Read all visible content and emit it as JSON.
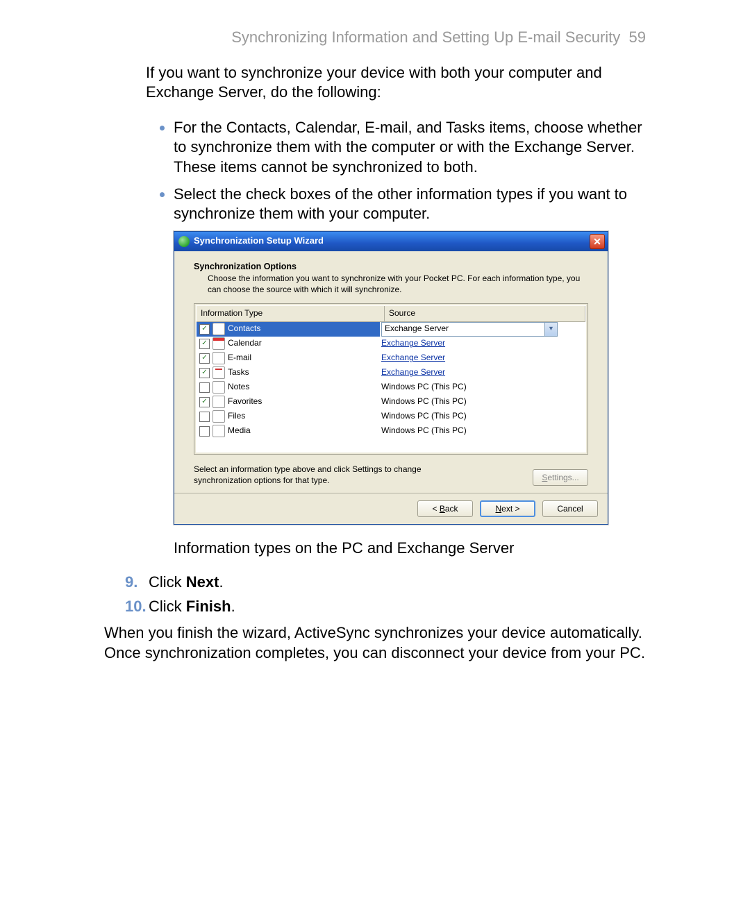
{
  "header": {
    "title": "Synchronizing Information and Setting Up E-mail Security",
    "page_number": "59"
  },
  "intro": "If you want to synchronize your device with both your computer and Exchange Server, do the following:",
  "bullets": [
    "For the Contacts, Calendar, E-mail, and Tasks items, choose whether to synchronize them with the computer or with the Exchange Server. These items cannot be synchronized to both.",
    "Select the check boxes of the other information types if you want to synchronize them with your computer."
  ],
  "dialog": {
    "title": "Synchronization Setup Wizard",
    "section_title": "Synchronization Options",
    "section_desc": "Choose the information you want to synchronize with your Pocket PC.  For each information type, you can choose the source with which it will synchronize.",
    "col1": "Information Type",
    "col2": "Source",
    "rows": [
      {
        "checked": true,
        "selected": true,
        "icon": "ic-contacts",
        "label": "Contacts",
        "source": "Exchange Server",
        "combo": true
      },
      {
        "checked": true,
        "selected": false,
        "icon": "ic-calendar",
        "label": "Calendar",
        "source": "Exchange Server",
        "link": true
      },
      {
        "checked": true,
        "selected": false,
        "icon": "ic-email",
        "label": "E-mail",
        "source": "Exchange Server",
        "link": true
      },
      {
        "checked": true,
        "selected": false,
        "icon": "ic-tasks",
        "label": "Tasks",
        "source": "Exchange Server",
        "link": true
      },
      {
        "checked": false,
        "selected": false,
        "icon": "ic-notes",
        "label": "Notes",
        "source": "Windows PC (This PC)"
      },
      {
        "checked": true,
        "selected": false,
        "icon": "ic-fav",
        "label": "Favorites",
        "source": "Windows PC (This PC)"
      },
      {
        "checked": false,
        "selected": false,
        "icon": "ic-files",
        "label": "Files",
        "source": "Windows PC (This PC)"
      },
      {
        "checked": false,
        "selected": false,
        "icon": "ic-media",
        "label": "Media",
        "source": "Windows PC (This PC)"
      }
    ],
    "hint": "Select an information type above and click Settings to change synchronization options for that type.",
    "settings_label": "Settings...",
    "back_label": "< Back",
    "next_label": "Next >",
    "cancel_label": "Cancel"
  },
  "caption": "Information types on the PC and Exchange Server",
  "steps": [
    {
      "n": "9.",
      "pre": "Click ",
      "bold": "Next",
      "post": "."
    },
    {
      "n": "10.",
      "pre": "Click ",
      "bold": "Finish",
      "post": "."
    }
  ],
  "conclusion": "When you finish the wizard, ActiveSync synchronizes your device automatically. Once synchronization completes, you can disconnect your device from your PC."
}
